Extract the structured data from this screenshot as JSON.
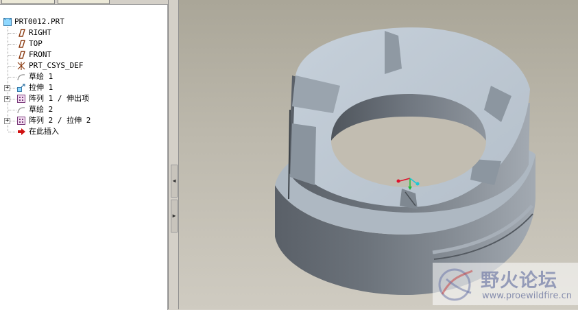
{
  "model_tree": {
    "root_label": "PRT0012.PRT",
    "items": [
      {
        "label": "RIGHT",
        "icon": "datum-plane-icon",
        "expandable": false
      },
      {
        "label": "TOP",
        "icon": "datum-plane-icon",
        "expandable": false
      },
      {
        "label": "FRONT",
        "icon": "datum-plane-icon",
        "expandable": false
      },
      {
        "label": "PRT_CSYS_DEF",
        "icon": "coordinate-system-icon",
        "expandable": false
      },
      {
        "label": "草绘 1",
        "icon": "sketch-icon",
        "expandable": false
      },
      {
        "label": "拉伸 1",
        "icon": "extrude-icon",
        "expandable": true
      },
      {
        "label": "阵列 1 / 伸出项",
        "icon": "pattern-icon",
        "expandable": true
      },
      {
        "label": "草绘 2",
        "icon": "sketch-icon",
        "expandable": false
      },
      {
        "label": "阵列 2 / 拉伸 2",
        "icon": "pattern-icon",
        "expandable": true
      },
      {
        "label": "在此插入",
        "icon": "insert-here-arrow-icon",
        "expandable": false
      }
    ]
  },
  "watermark": {
    "title": "野火论坛",
    "url": "www.proewildfire.cn"
  },
  "colors": {
    "part_face": "#c3cdd7",
    "part_side": "#5f666e",
    "viewport_bg": "#bdb9ad",
    "csys_x": "#e0102a",
    "csys_y": "#22bb33",
    "csys_z": "#19c8d8"
  }
}
